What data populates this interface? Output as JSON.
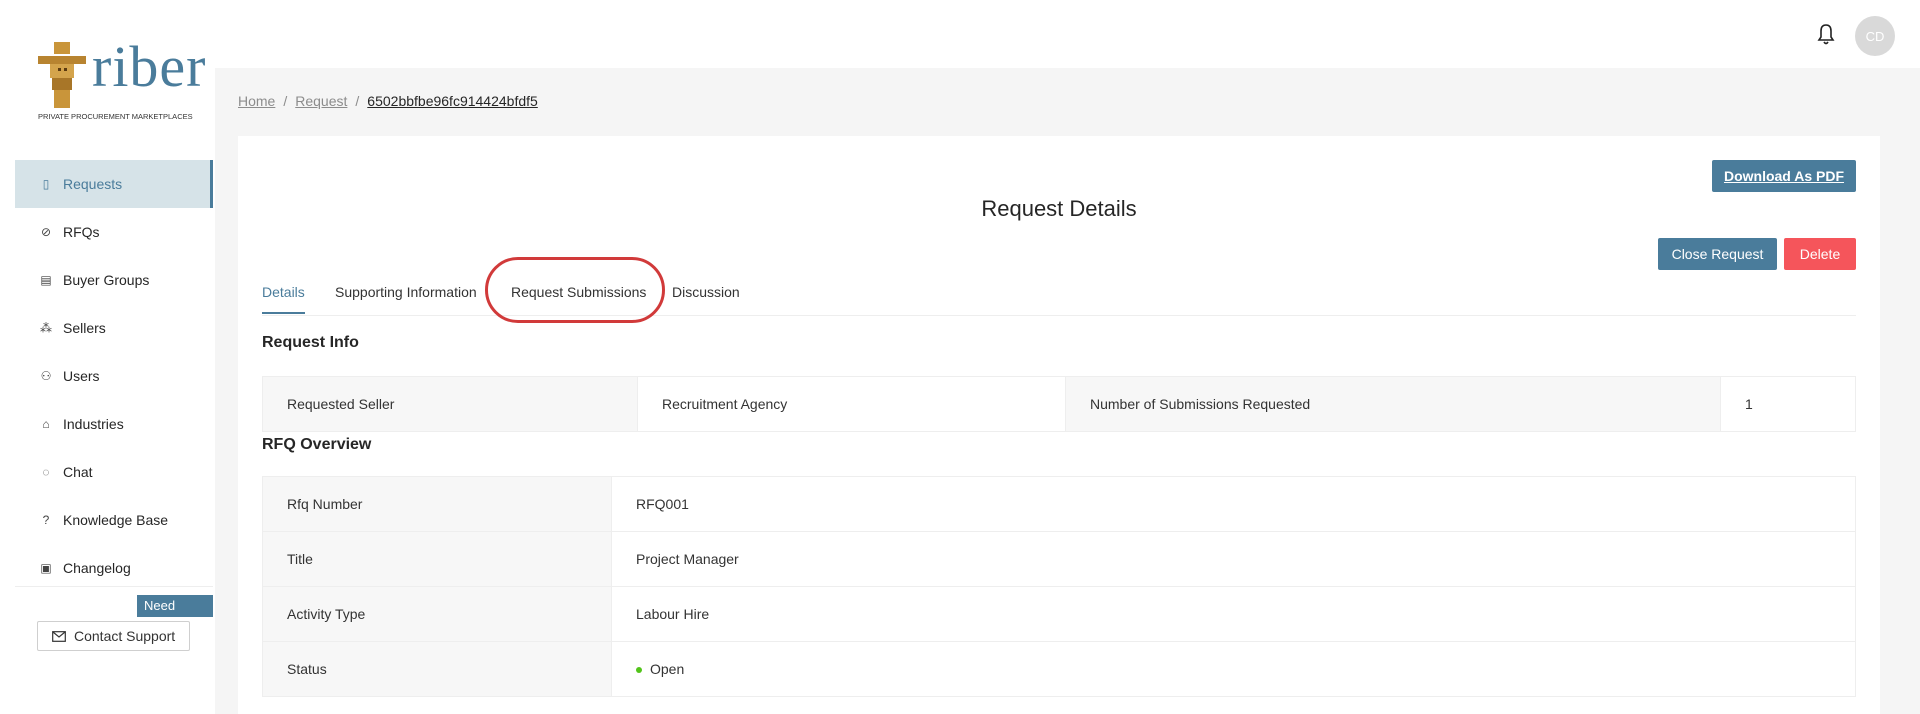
{
  "logo": {
    "word": "riber",
    "subtitle": "PRIVATE PROCUREMENT MARKETPLACES"
  },
  "header": {
    "avatar_initials": "CD"
  },
  "sidebar": {
    "items": [
      {
        "label": "Requests",
        "icon": "document-icon",
        "glyph": "▯"
      },
      {
        "label": "RFQs",
        "icon": "paperclip-icon",
        "glyph": "⊘"
      },
      {
        "label": "Buyer Groups",
        "icon": "building-icon",
        "glyph": "▤"
      },
      {
        "label": "Sellers",
        "icon": "cluster-icon",
        "glyph": "⁂"
      },
      {
        "label": "Users",
        "icon": "users-icon",
        "glyph": "⚇"
      },
      {
        "label": "Industries",
        "icon": "bank-icon",
        "glyph": "⌂"
      },
      {
        "label": "Chat",
        "icon": "chat-icon",
        "glyph": "◌"
      },
      {
        "label": "Knowledge Base",
        "icon": "question-icon",
        "glyph": "?"
      },
      {
        "label": "Changelog",
        "icon": "clipboard-icon",
        "glyph": "▣"
      }
    ],
    "need_help": "Need help?",
    "contact_support": "Contact Support"
  },
  "breadcrumb": {
    "home": "Home",
    "request": "Request",
    "current": "6502bbfbe96fc914424bfdf5"
  },
  "page": {
    "title": "Request Details",
    "download_pdf": "Download As PDF",
    "close_request": "Close Request",
    "delete": "Delete"
  },
  "tabs": [
    "Details",
    "Supporting Information",
    "Request Submissions",
    "Discussion"
  ],
  "request_info": {
    "heading": "Request Info",
    "requested_seller_label": "Requested Seller",
    "requested_seller_value": "Recruitment Agency",
    "num_submissions_label": "Number of Submissions Requested",
    "num_submissions_value": "1"
  },
  "rfq_overview": {
    "heading": "RFQ Overview",
    "rows": [
      {
        "label": "Rfq Number",
        "value": "RFQ001"
      },
      {
        "label": "Title",
        "value": "Project Manager"
      },
      {
        "label": "Activity Type",
        "value": "Labour Hire"
      },
      {
        "label": "Status",
        "value": "Open"
      }
    ]
  }
}
